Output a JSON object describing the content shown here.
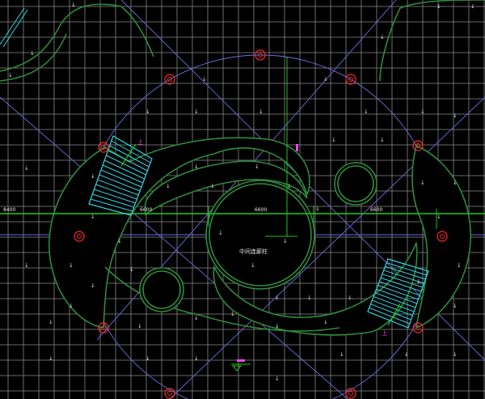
{
  "drawing": {
    "dimension_labels": [
      "8400",
      "6600",
      "6600",
      "6600"
    ],
    "center_label": "中间连廊柱",
    "up_marks": [
      "上",
      "上"
    ],
    "flow_glyph": "↓",
    "colors": {
      "background": "#000000",
      "grid": "#8a8a8a",
      "axis": "#1ec81e",
      "guide": "#6d6de0",
      "path": "#2e8b3a",
      "column": "#ff2a2a",
      "stair": "#2fd7e6",
      "tag": "#ff40ff"
    }
  }
}
